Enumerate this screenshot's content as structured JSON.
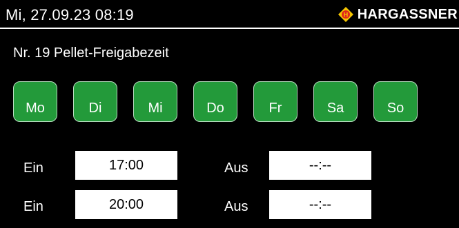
{
  "header": {
    "datetime": "Mi, 27.09.23 08:19",
    "brand": "HARGASSNER",
    "brand_logo_letter": "H",
    "brand_colors": {
      "diamond": "#f4c400",
      "ring": "#e0261b"
    }
  },
  "page": {
    "title": "Nr. 19 Pellet-Freigabezeit"
  },
  "days": [
    {
      "label": "Mo",
      "active": true
    },
    {
      "label": "Di",
      "active": true
    },
    {
      "label": "Mi",
      "active": true
    },
    {
      "label": "Do",
      "active": true
    },
    {
      "label": "Fr",
      "active": true
    },
    {
      "label": "Sa",
      "active": true
    },
    {
      "label": "So",
      "active": true
    }
  ],
  "day_active_color": "#239a3a",
  "schedule": [
    {
      "on_label": "Ein",
      "on_time": "17:00",
      "off_label": "Aus",
      "off_time": "--:--"
    },
    {
      "on_label": "Ein",
      "on_time": "20:00",
      "off_label": "Aus",
      "off_time": "--:--"
    }
  ]
}
